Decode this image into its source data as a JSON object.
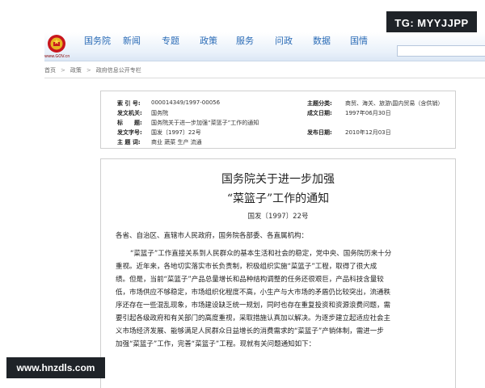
{
  "watermarks": {
    "top_right": "TG: MYYJJPP",
    "bottom_left": "www.hnzdls.com"
  },
  "header": {
    "logo_icon": "national-emblem-icon",
    "site_url": "www.GOV.cn",
    "nav": [
      "国务院",
      "新闻",
      "专题",
      "政策",
      "服务",
      "问政",
      "数据",
      "国情"
    ],
    "colors": {
      "nav_text": "#2a6bb6",
      "emblem": "#c8161d"
    }
  },
  "breadcrumb": [
    "首页",
    "政策",
    "政府信息公开专栏"
  ],
  "meta": {
    "left": [
      {
        "label": "索 引 号:",
        "value": "000014349/1997-00056"
      },
      {
        "label": "发文机关:",
        "value": "国务院"
      },
      {
        "label": "标　　题:",
        "value": "国务院关于进一步加强“菜篮子”工作的通知"
      },
      {
        "label": "发文字号:",
        "value": "国发〔1997〕22号"
      },
      {
        "label": "主 题 词:",
        "value": "商业 蔬菜 生产 流通"
      }
    ],
    "right": [
      {
        "label": "主题分类:",
        "value": "商贸、海关、旅游\\国内贸易（含供销）"
      },
      {
        "label": "成文日期:",
        "value": "1997年06月30日"
      },
      {
        "label": "发布日期:",
        "value": "2010年12月03日"
      }
    ]
  },
  "document": {
    "title_line1": "国务院关于进一步加强",
    "title_line2": "“菜篮子”工作的通知",
    "number": "国发〔1997〕22号",
    "addressee": "各省、自治区、直辖市人民政府，国务院各部委、各直属机构：",
    "paragraph_lines": [
      "“菜篮子”工作直接关系到人民群众的基本生活和社会的稳定，党中央、国务院历来十分",
      "重视。近年来，各地切实落实市长负责制，积极组织实施“菜篮子”工程，取得了很大成",
      "绩。但是，当前“菜篮子”产品总量增长和品种结构调整的任务还很艰巨，产品科技含量较",
      "低，市场供应不够稳定，市场组织化程度不高，小生产与大市场的矛盾仍比较突出，流通秩",
      "序还存在一些混乱现象，市场建设缺乏统一规划，同时也存在重复投资和资源浪费问题，需",
      "要引起各级政府和有关部门的高度重视，采取措施认真加以解决。为逐步建立起适应社会主",
      "义市场经济发展、能够满足人民群众日益增长的消费需求的“菜篮子”产销体制，需进一步",
      "加强“菜篮子”工作，完善“菜篮子”工程。现就有关问题通知如下："
    ]
  }
}
